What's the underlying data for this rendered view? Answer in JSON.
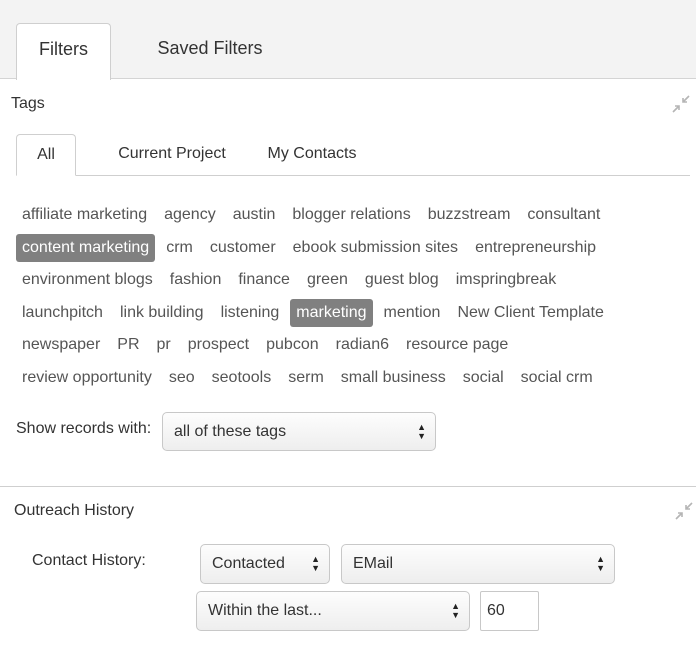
{
  "top_tabs": {
    "filters": "Filters",
    "saved_filters": "Saved Filters"
  },
  "tags_panel": {
    "title": "Tags",
    "tabs": {
      "all": "All",
      "current_project": "Current Project",
      "my_contacts": "My Contacts"
    },
    "rows": [
      [
        "affiliate marketing",
        "agency",
        "austin",
        "blogger relations",
        "buzzstream",
        "consultant"
      ],
      [
        "content marketing",
        "crm",
        "customer",
        "ebook submission sites",
        "entrepreneurship"
      ],
      [
        "environment blogs",
        "fashion",
        "finance",
        "green",
        "guest blog",
        "imspringbreak"
      ],
      [
        "launchpitch",
        "link building",
        "listening",
        "marketing",
        "mention",
        "New Client Template"
      ],
      [
        "newspaper",
        "PR",
        "pr",
        "prospect",
        "pubcon",
        "radian6",
        "resource page"
      ],
      [
        "review opportunity",
        "seo",
        "seotools",
        "serm",
        "small business",
        "social",
        "social crm"
      ]
    ],
    "selected_tags": [
      "content marketing",
      "marketing"
    ],
    "show_records_label": "Show records with:",
    "show_records_value": "all of these tags"
  },
  "outreach_panel": {
    "title": "Outreach History",
    "contact_history_label": "Contact History:",
    "status_select": "Contacted",
    "channel_select": "EMail",
    "period_select": "Within the last...",
    "days_value": "60"
  },
  "colors": {
    "selected_tag_bg": "#808080",
    "tab_bar_bg": "#f3f3f3",
    "border": "#cfcfcf"
  },
  "icons": {
    "collapse": "collapse-arrows-icon",
    "select_arrows": "up-down-arrows-icon"
  }
}
